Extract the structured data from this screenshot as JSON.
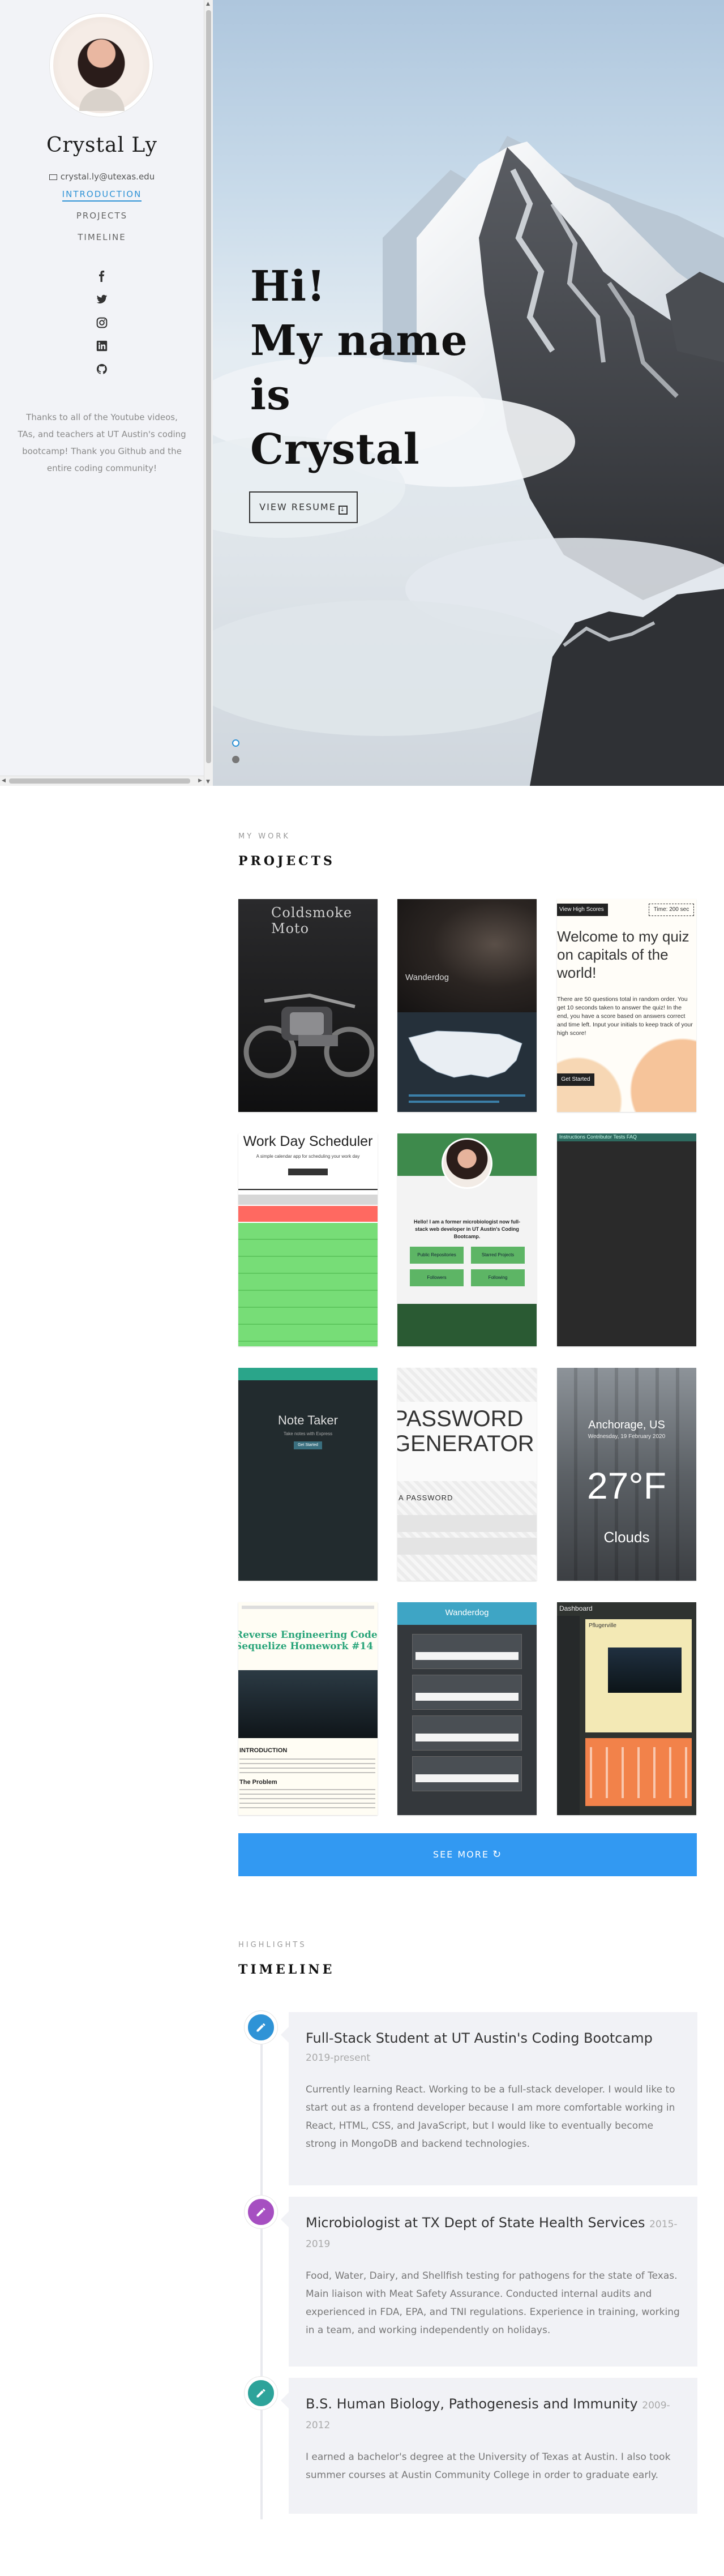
{
  "sidebar": {
    "name": "Crystal Ly",
    "email": "crystal.ly@utexas.edu",
    "nav": [
      {
        "label": "INTRODUCTION",
        "active": true
      },
      {
        "label": "PROJECTS",
        "active": false
      },
      {
        "label": "TIMELINE",
        "active": false
      }
    ],
    "socials": [
      "facebook-icon",
      "twitter-icon",
      "instagram-icon",
      "linkedin-icon",
      "github-icon"
    ],
    "thanks": "Thanks to all of the Youtube videos, TAs, and teachers at UT Austin's coding bootcamp! Thank you Github and the entire coding community!"
  },
  "hero": {
    "greeting_lines": [
      "Hi!",
      "My name",
      "is",
      "Crystal"
    ],
    "resume_label": "VIEW RESUME",
    "slides": 2,
    "active_slide": 1
  },
  "projects": {
    "kicker": "MY WORK",
    "title": "PROJECTS",
    "items": [
      {
        "id": "coldsmoke",
        "title": "Coldsmoke Moto"
      },
      {
        "id": "wanderdog",
        "title": "Wanderdog"
      },
      {
        "id": "quiz",
        "banner": "View High Scores",
        "timer": "Time: 200 sec",
        "heading": "Welcome to my quiz on capitals of the world!",
        "body": "There are 50 questions total in random order. You get 10 seconds taken to answer the quiz! In the end, you have a score based on answers correct and time left. Input your initials to keep track of your high score!",
        "button": "Get Started"
      },
      {
        "id": "scheduler",
        "title": "Work Day Scheduler",
        "subtitle": "A simple calendar app for scheduling your work day"
      },
      {
        "id": "profile",
        "heading": "Hello! I am a former microbiologist now full-stack web developer in UT Austin's Coding Bootcamp.",
        "stats": [
          "Public Repositories",
          "Starred Projects",
          "Followers",
          "Following"
        ]
      },
      {
        "id": "dark",
        "tabs": "Instructions  Contributor  Tests  FAQ"
      },
      {
        "id": "notetaker",
        "title": "Note Taker",
        "subtitle": "Take notes with Express",
        "button": "Get Started"
      },
      {
        "id": "password",
        "title": "PASSWORD GENERATOR",
        "sub": "A PASSWORD"
      },
      {
        "id": "weather",
        "city": "Anchorage, US",
        "date": "Wednesday, 19 February 2020",
        "temp": "27°F",
        "desc": "Clouds"
      },
      {
        "id": "readme",
        "heading": "Reverse Engineering Code Sequelize Homework #14",
        "intro": "INTRODUCTION",
        "problem": "The Problem"
      },
      {
        "id": "wanderdog2",
        "title": "Wanderdog"
      },
      {
        "id": "dashboard",
        "title": "Dashboard",
        "city": "Pflugerville"
      }
    ],
    "see_more": "SEE MORE"
  },
  "timeline": {
    "kicker": "HIGHLIGHTS",
    "title": "TIMELINE",
    "entries": [
      {
        "title": "Full-Stack Student at UT Austin's Coding Bootcamp",
        "date": "2019-present",
        "body": "Currently learning React. Working to be a full-stack developer. I would like to start out as a frontend developer because I am more comfortable working in React, HTML, CSS, and JavaScript, but I would like to eventually become strong in MongoDB and backend technologies.",
        "color": "#2f93d6"
      },
      {
        "title": "Microbiologist at TX Dept of State Health Services",
        "date": "2015-2019",
        "body": "Food, Water, Dairy, and Shellfish testing for pathogens for the state of Texas. Main liaison with Meat Safety Assurance. Conducted internal audits and experienced in FDA, EPA, and TNI regulations. Experience in training, working in a team, and working independently on holidays.",
        "color": "#a64fc1"
      },
      {
        "title": "B.S. Human Biology, Pathogenesis and Immunity",
        "date": "2009-2012",
        "body": "I earned a bachelor's degree at the University of Texas at Austin. I also took summer courses at Austin Community College in order to graduate early.",
        "color": "#2da39a"
      }
    ]
  }
}
